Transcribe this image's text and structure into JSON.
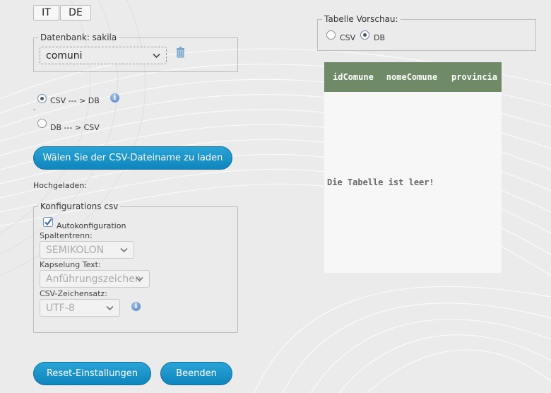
{
  "lang_buttons": [
    "IT",
    "DE"
  ],
  "db_box": {
    "legend": "Datenbank: sakila",
    "select_value": "comuni"
  },
  "direction": {
    "csv_to_db": "CSV --- > DB",
    "db_to_csv": "DB --- > CSV",
    "separator": "-"
  },
  "choose_button": "Wälen Sie der CSV-Dateiname zu laden",
  "uploaded_label": "Hochgeladen:",
  "config": {
    "legend": "Konfigurations csv",
    "autoconfig": "Autokonfiguration",
    "sep_label": "Spaltentrenn:",
    "sep_value": "SEMIKOLON",
    "quote_label": "Kapselung Text:",
    "quote_value": "Anführungszeichen",
    "charset_label": "CSV-Zeichensatz:",
    "charset_value": "UTF-8"
  },
  "reset_button": "Reset-Einstallungen",
  "finish_button": "Beenden",
  "preview": {
    "legend": "Tabelle Vorschau:",
    "opt_csv": "CSV",
    "opt_db": "DB",
    "columns": [
      "idComune",
      "nomeComune",
      "provincia"
    ],
    "empty_message": "Die Tabelle ist leer!"
  },
  "colors": {
    "accent_button": "#1697cb",
    "table_header": "#6e8a66"
  }
}
